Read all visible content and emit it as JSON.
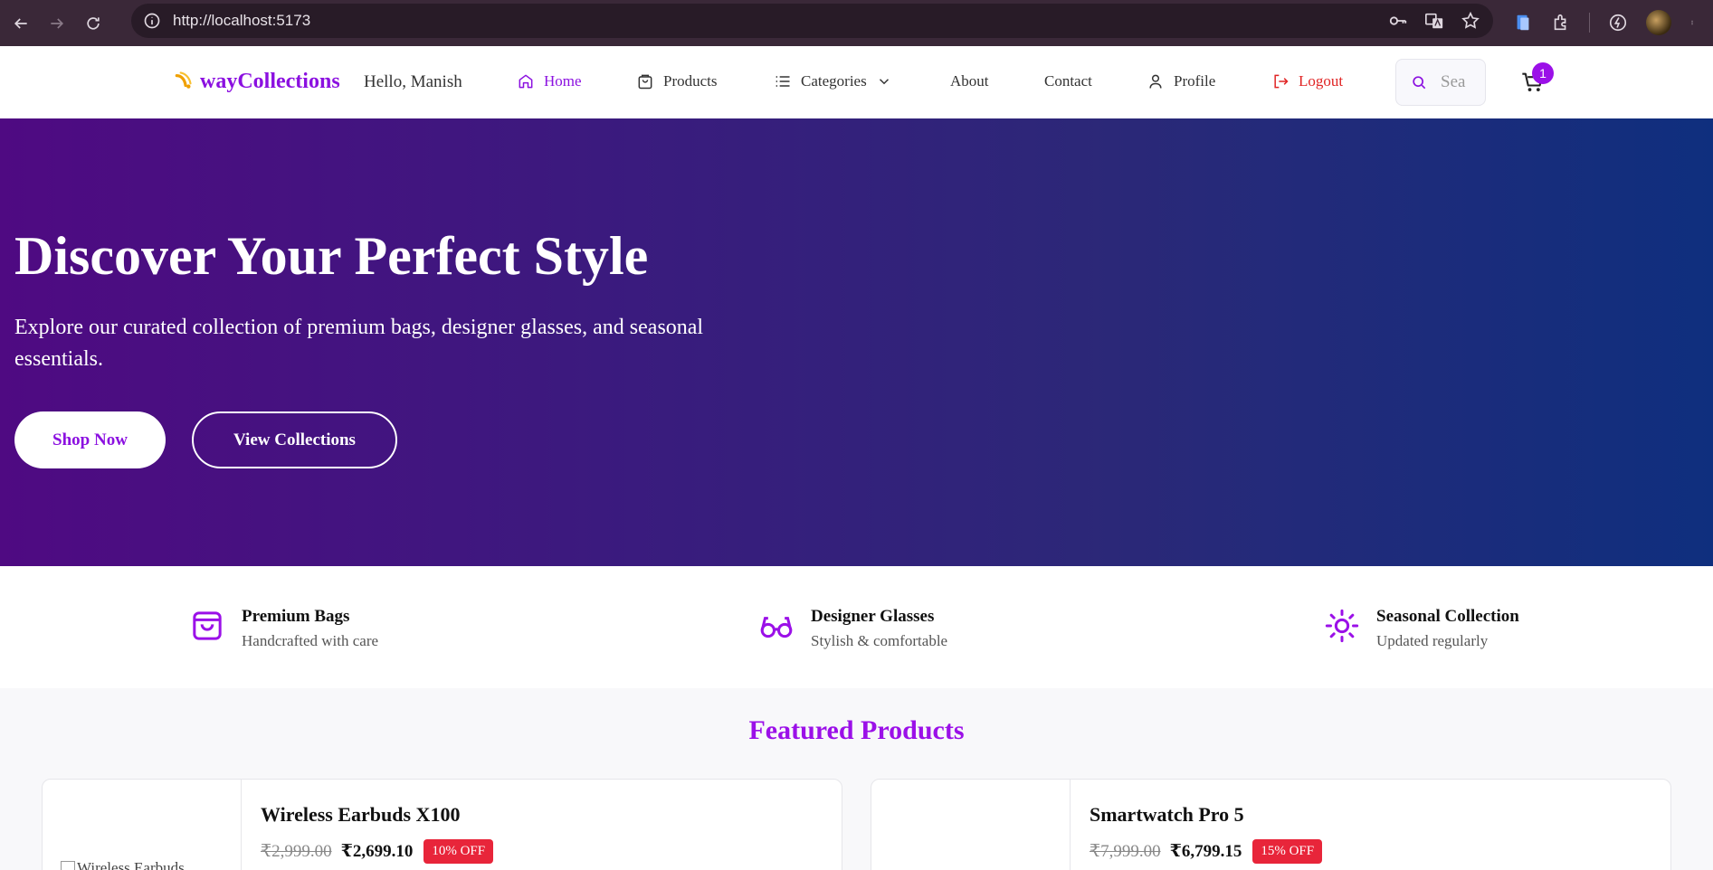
{
  "browser": {
    "url": "http://localhost:5173"
  },
  "navbar": {
    "brand": "wayCollections",
    "greeting": "Hello, Manish",
    "items": [
      {
        "label": "Home",
        "icon": "home-icon"
      },
      {
        "label": "Products",
        "icon": "shopping-bag-icon"
      },
      {
        "label": "Categories",
        "icon": "list-icon"
      },
      {
        "label": "About"
      },
      {
        "label": "Contact"
      },
      {
        "label": "Profile",
        "icon": "user-icon"
      },
      {
        "label": "Logout",
        "icon": "logout-icon"
      }
    ],
    "search_placeholder": "Sea",
    "cart_count": "1"
  },
  "hero": {
    "title": "Discover Your Perfect Style",
    "subtitle": "Explore our curated collection of premium bags, designer glasses, and seasonal essentials.",
    "primary_button": "Shop Now",
    "secondary_button": "View Collections"
  },
  "features": [
    {
      "title": "Premium Bags",
      "subtitle": "Handcrafted with care",
      "icon": "bag-icon"
    },
    {
      "title": "Designer Glasses",
      "subtitle": "Stylish & comfortable",
      "icon": "glasses-icon"
    },
    {
      "title": "Seasonal Collection",
      "subtitle": "Updated regularly",
      "icon": "sun-icon"
    }
  ],
  "featured": {
    "heading": "Featured Products",
    "products": [
      {
        "name": "Wireless Earbuds X100",
        "old_price": "₹2,999.00",
        "price": "₹2,699.10",
        "discount": "10% OFF",
        "image_alt": "Wireless Earbuds"
      },
      {
        "name": "Smartwatch Pro 5",
        "old_price": "₹7,999.00",
        "price": "₹6,799.15",
        "discount": "15% OFF",
        "image_alt": ""
      }
    ]
  },
  "colors": {
    "brand": "#8b10e0",
    "logout": "#e02424",
    "discount": "#e8253a",
    "hero_start": "#4f0a82",
    "hero_end": "#0f2f7e"
  }
}
